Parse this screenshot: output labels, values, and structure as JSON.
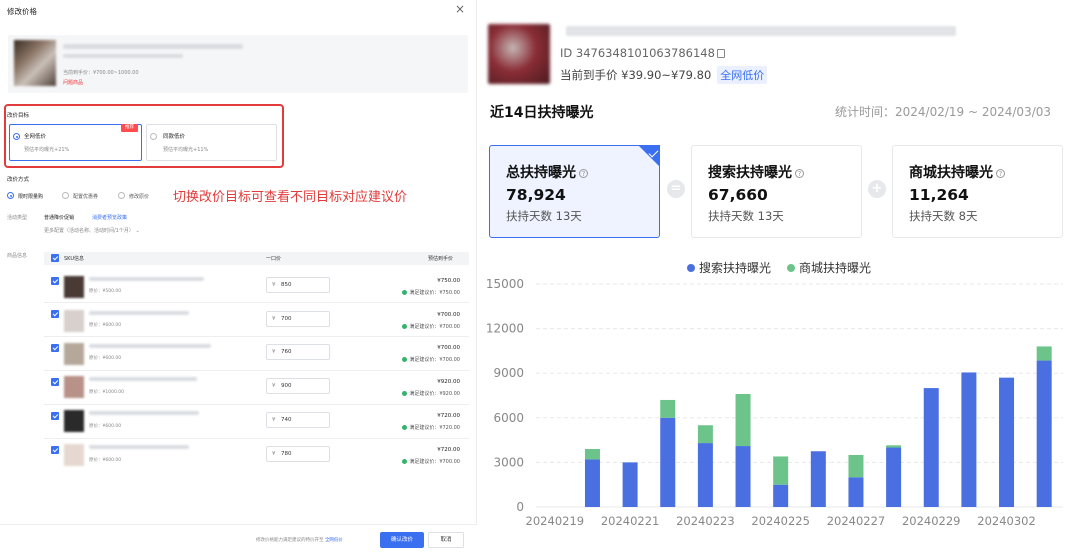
{
  "left": {
    "modal_title": "修改价格",
    "close": "×",
    "product": {
      "price_line": "当前到手价：¥700.00~1000.00",
      "tag": "问题商品"
    },
    "goal": {
      "section": "改价目标",
      "options": [
        {
          "title": "全网低价",
          "sub": "预估平均曝光+21%",
          "selected": true,
          "badge": "推荐"
        },
        {
          "title": "同款低价",
          "sub": "预估平均曝光+11%",
          "selected": false
        }
      ]
    },
    "method": {
      "section": "改价方式",
      "options": [
        {
          "label": "限时限量购",
          "selected": true
        },
        {
          "label": "配置优惠券",
          "selected": false
        },
        {
          "label": "修改原价",
          "selected": false
        }
      ],
      "activity_label": "活动类型",
      "activity_value": "普通降价促销",
      "activity_link": "消费者预览政策",
      "more": "更多配置（活动名称、活动时间/1个月） ⌄"
    },
    "annotation": "切换改价目标可查看不同目标对应建议价",
    "table": {
      "section": "商品信息",
      "headers": [
        "SKU信息",
        "一口价",
        "预估到手价"
      ],
      "rows": [
        {
          "orig": "原价：¥500.00",
          "price": "850",
          "suggest": "¥750.00",
          "suggest_note": "满足建议价：¥750.00",
          "thumb": "#4a3a36"
        },
        {
          "orig": "原价：¥600.00",
          "price": "700",
          "suggest": "¥700.00",
          "suggest_note": "满足建议价：¥700.00",
          "thumb": "#d8d0cc"
        },
        {
          "orig": "原价：¥600.00",
          "price": "760",
          "suggest": "¥700.00",
          "suggest_note": "满足建议价：¥700.00",
          "thumb": "#b5a89a"
        },
        {
          "orig": "原价：¥1000.00",
          "price": "900",
          "suggest": "¥920.00",
          "suggest_note": "满足建议价：¥920.00",
          "thumb": "#b89288"
        },
        {
          "orig": "原价：¥600.00",
          "price": "740",
          "suggest": "¥720.00",
          "suggest_note": "满足建议价：¥720.00",
          "thumb": "#2a2a2a"
        },
        {
          "orig": "原价：¥600.00",
          "price": "780",
          "suggest": "¥720.00",
          "suggest_note": "满足建议价：¥700.00",
          "thumb": "#e6d8d0"
        }
      ]
    },
    "footer": {
      "note": "修改价格能力满足建议的特价开至",
      "note_link": "全网低价",
      "confirm": "确认改价",
      "cancel": "取消"
    }
  },
  "right": {
    "product": {
      "id_line": "ID 3476348101063786148",
      "price_line": "当前到手价 ¥39.90~¥79.80",
      "badge": "全网低价"
    },
    "title": "近14日扶持曝光",
    "stat_time": "统计时间：2024/02/19 ~ 2024/03/03",
    "metrics": [
      {
        "label": "总扶持曝光",
        "value": "78,924",
        "days": "扶持天数 13天",
        "selected": true
      },
      {
        "label": "搜索扶持曝光",
        "value": "67,660",
        "days": "扶持天数 13天",
        "selected": false
      },
      {
        "label": "商城扶持曝光",
        "value": "11,264",
        "days": "扶持天数 8天",
        "selected": false
      }
    ],
    "ops": [
      "=",
      "+"
    ]
  },
  "colors": {
    "accent": "#3a6ff0",
    "search": "#4a6fe0",
    "mall": "#6cc48a",
    "highlight_red": "#e23b3b"
  },
  "chart_data": {
    "type": "bar",
    "stacked": true,
    "categories": [
      "20240219",
      "20240220",
      "20240221",
      "20240222",
      "20240223",
      "20240224",
      "20240225",
      "20240226",
      "20240227",
      "20240228",
      "20240229",
      "20240301",
      "20240302",
      "20240303"
    ],
    "tick_labels": [
      "20240219",
      "20240221",
      "20240223",
      "20240225",
      "20240227",
      "20240229",
      "20240302"
    ],
    "series": [
      {
        "name": "搜索扶持曝光",
        "color": "#4a6fe0",
        "values": [
          0,
          3200,
          3000,
          6000,
          4300,
          4100,
          1500,
          3750,
          2000,
          4000,
          8000,
          9050,
          8700,
          9850
        ]
      },
      {
        "name": "商城扶持曝光",
        "color": "#6cc48a",
        "values": [
          0,
          700,
          0,
          1200,
          1200,
          3500,
          1900,
          0,
          1500,
          150,
          0,
          0,
          0,
          950
        ]
      }
    ],
    "yticks": [
      0,
      3000,
      6000,
      9000,
      12000,
      15000
    ],
    "ylim": [
      0,
      15000
    ],
    "legend_position": "top-center"
  }
}
